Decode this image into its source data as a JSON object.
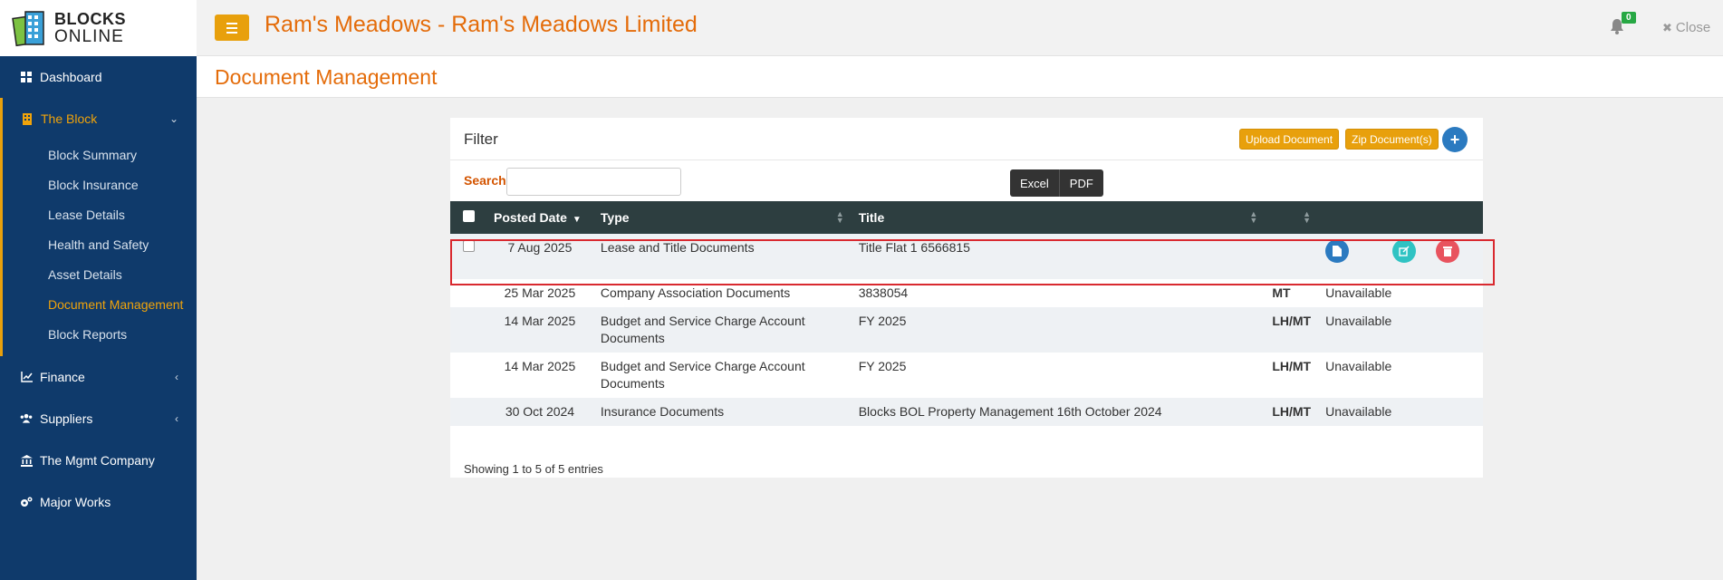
{
  "logo": {
    "line1": "BLOCKS",
    "line2": "ONLINE"
  },
  "sidebar": {
    "items": [
      {
        "label": "Dashboard"
      },
      {
        "label": "The Block"
      },
      {
        "label": "Finance"
      },
      {
        "label": "Suppliers"
      },
      {
        "label": "The Mgmt Company"
      },
      {
        "label": "Major Works"
      }
    ],
    "block_sub": [
      "Block Summary",
      "Block Insurance",
      "Lease Details",
      "Health and Safety",
      "Asset Details",
      "Document Management",
      "Block Reports"
    ]
  },
  "header": {
    "title": "Ram's Meadows - Ram's Meadows Limited",
    "notification_count": "0",
    "close_label": "Close"
  },
  "page": {
    "title": "Document Management"
  },
  "filter": {
    "title": "Filter",
    "upload_label": "Upload Document",
    "zip_label": "Zip Document(s)",
    "add_label": "+",
    "search_label": "Search",
    "search_value": "",
    "excel_label": "Excel",
    "pdf_label": "PDF"
  },
  "table": {
    "headers": {
      "posted_date": "Posted Date",
      "type": "Type",
      "title": "Title",
      "col4": "",
      "col5": ""
    },
    "rows": [
      {
        "date": "7 Aug 2025",
        "type": "Lease and Title Documents",
        "title": "Title Flat 1 6566815",
        "access": "",
        "status": ""
      },
      {
        "date": "25 Mar 2025",
        "type": "Company Association Documents",
        "title": "3838054",
        "access": "MT",
        "status": "Unavailable"
      },
      {
        "date": "14 Mar 2025",
        "type": "Budget and Service Charge Account Documents",
        "title": "FY 2025",
        "access": "LH/MT",
        "status": "Unavailable"
      },
      {
        "date": "14 Mar 2025",
        "type": "Budget and Service Charge Account Documents",
        "title": "FY 2025",
        "access": "LH/MT",
        "status": "Unavailable"
      },
      {
        "date": "30 Oct 2024",
        "type": "Insurance Documents",
        "title": "Blocks BOL Property Management 16th October 2024",
        "access": "LH/MT",
        "status": "Unavailable"
      }
    ],
    "info": "Showing 1 to 5 of 5 entries"
  },
  "colors": {
    "accent": "#e8a00c",
    "title": "#e46c0a",
    "sidebar": "#0f3a6b",
    "header_row": "#2d3e40",
    "highlight": "#d9292f"
  }
}
